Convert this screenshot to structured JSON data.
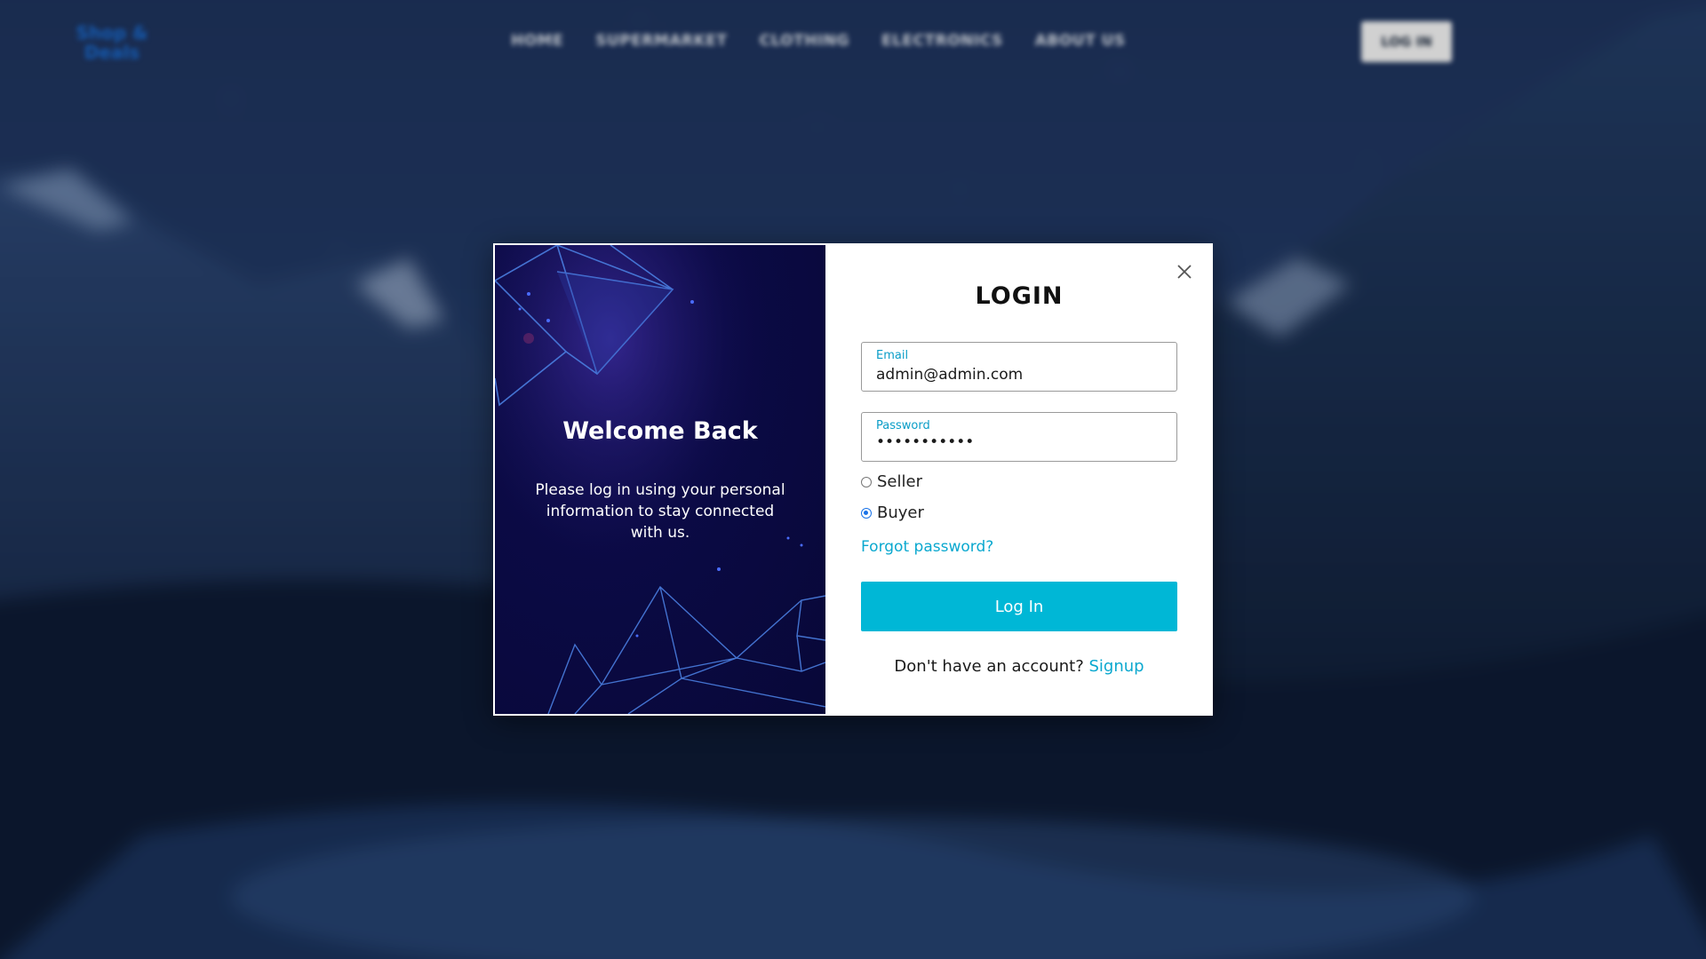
{
  "nav": {
    "logo_line1": "Shop &",
    "logo_line2": "Deals",
    "links": [
      "HOME",
      "SUPERMARKET",
      "CLOTHING",
      "ELECTRONICS",
      "ABOUT US"
    ],
    "login_label": "LOG IN"
  },
  "modal": {
    "welcome_title": "Welcome Back",
    "welcome_text": "Please log in using your personal information to stay connected with us.",
    "title": "LOGIN",
    "email": {
      "label": "Email",
      "value": "admin@admin.com"
    },
    "password": {
      "label": "Password",
      "masked_value": "•••••••••••"
    },
    "roles": [
      {
        "label": "Seller",
        "checked": false
      },
      {
        "label": "Buyer",
        "checked": true
      }
    ],
    "forgot_label": "Forgot password?",
    "login_button": "Log In",
    "signup_prompt": "Don't have an account?",
    "signup_link": "Signup"
  },
  "colors": {
    "accent": "#00b7d6",
    "link": "#0aa8cf",
    "panel_dark": "#0b0a45"
  }
}
